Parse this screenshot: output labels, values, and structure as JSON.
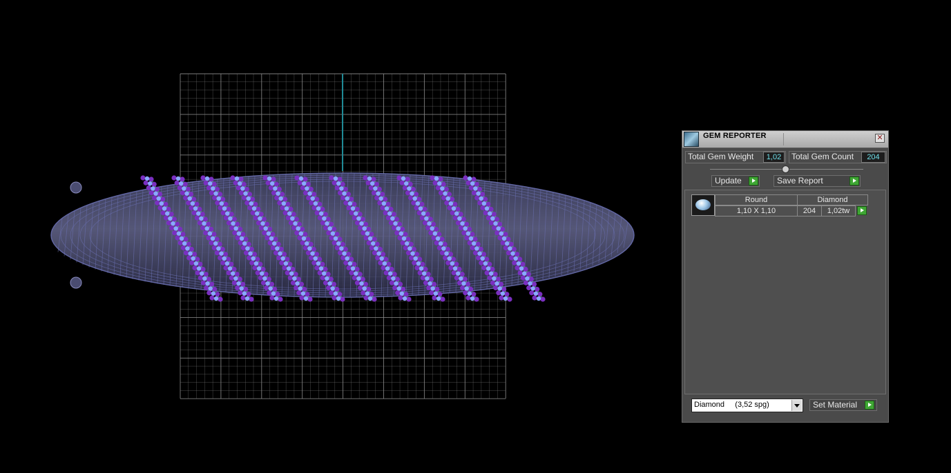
{
  "panel": {
    "title": "GEM REPORTER",
    "close_glyph": "✕",
    "total_weight_label": "Total Gem Weight",
    "total_weight_value": "1,02",
    "total_count_label": "Total Gem Count",
    "total_count_value": "204",
    "update_label": "Update",
    "save_report_label": "Save Report",
    "gems": [
      {
        "shape": "Round",
        "size": "1,10 X 1,10",
        "material": "Diamond",
        "count": "204",
        "weight": "1,02tw",
        "icon": "round-gem-icon"
      }
    ],
    "material_select": "Diamond     (3,52 spg)",
    "set_material_label": "Set Material"
  },
  "colors": {
    "background": "#000000",
    "panel_bg": "#4a4a4a",
    "value_text": "#6fe0ea",
    "go_button": "#3fa634",
    "gem_purple": "#7a2fc0",
    "gem_blue": "#8aa8ff",
    "band_wire": "#6a6fb0",
    "grid": "#8c8c8c",
    "axis": "#1f8a96"
  },
  "icons": {
    "title": "gem-reporter-icon",
    "close": "close-icon",
    "go": "arrow-right-icon",
    "dropdown": "chevron-down-icon"
  }
}
